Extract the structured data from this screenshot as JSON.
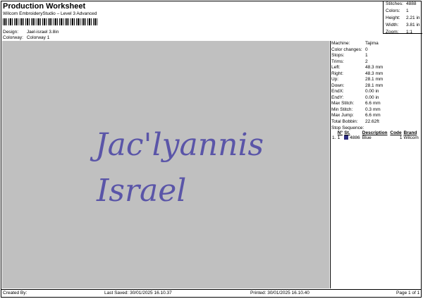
{
  "header": {
    "title": "Production Worksheet",
    "subtitle": "Wilcom EmbroideryStudio – Level 3 Advanced"
  },
  "design_info": [
    {
      "label": "Design:",
      "value": "Jael-israel 3.8in"
    },
    {
      "label": "Colorway:",
      "value": "Colorway 1"
    }
  ],
  "stats": [
    {
      "label": "Stitches:",
      "value": "4888"
    },
    {
      "label": "Colors:",
      "value": "1"
    },
    {
      "label": "Height:",
      "value": "2.21 in"
    },
    {
      "label": "Width:",
      "value": "3.81 in"
    },
    {
      "label": "Zoom:",
      "value": "1:1"
    }
  ],
  "machine_info": [
    {
      "label": "Machine:",
      "value": "Tajima"
    },
    {
      "label": "Color changes:",
      "value": "0"
    },
    {
      "label": "Stops:",
      "value": "1"
    },
    {
      "label": "Trims:",
      "value": "2"
    },
    {
      "label": "Left:",
      "value": "48.3 mm"
    },
    {
      "label": "Right:",
      "value": "48.3 mm"
    },
    {
      "label": "Up:",
      "value": "28.1 mm"
    },
    {
      "label": "Down:",
      "value": "28.1 mm"
    },
    {
      "label": "EndX:",
      "value": "0.00 in"
    },
    {
      "label": "EndY:",
      "value": "0.00 in"
    },
    {
      "label": "Max Stitch:",
      "value": "6.6 mm"
    },
    {
      "label": "Min Stitch:",
      "value": "0.3 mm"
    },
    {
      "label": "Max Jump:",
      "value": "6.6 mm"
    },
    {
      "label": "Total Bobbin:",
      "value": "22.62ft"
    }
  ],
  "stop_sequence": {
    "title": "Stop Sequence:",
    "columns": [
      "Nº",
      "St.",
      "Description",
      "Code",
      "Brand"
    ],
    "rows": [
      {
        "index": "1.",
        "n": "1",
        "st": "4886",
        "description": "Blue",
        "code": "1",
        "brand": "Wilcom",
        "color": "#2e2e80"
      }
    ]
  },
  "design_text": {
    "line1": "Jac'lyannis",
    "line2": "Israel",
    "thread_color": "#5a55a8"
  },
  "footer": {
    "created_by": "Created By:",
    "last_saved": "Last Saved: 30/01/2025 16.10.37",
    "printed": "Printed: 30/01/2025 16.10.40",
    "page": "Page 1 of 1"
  }
}
